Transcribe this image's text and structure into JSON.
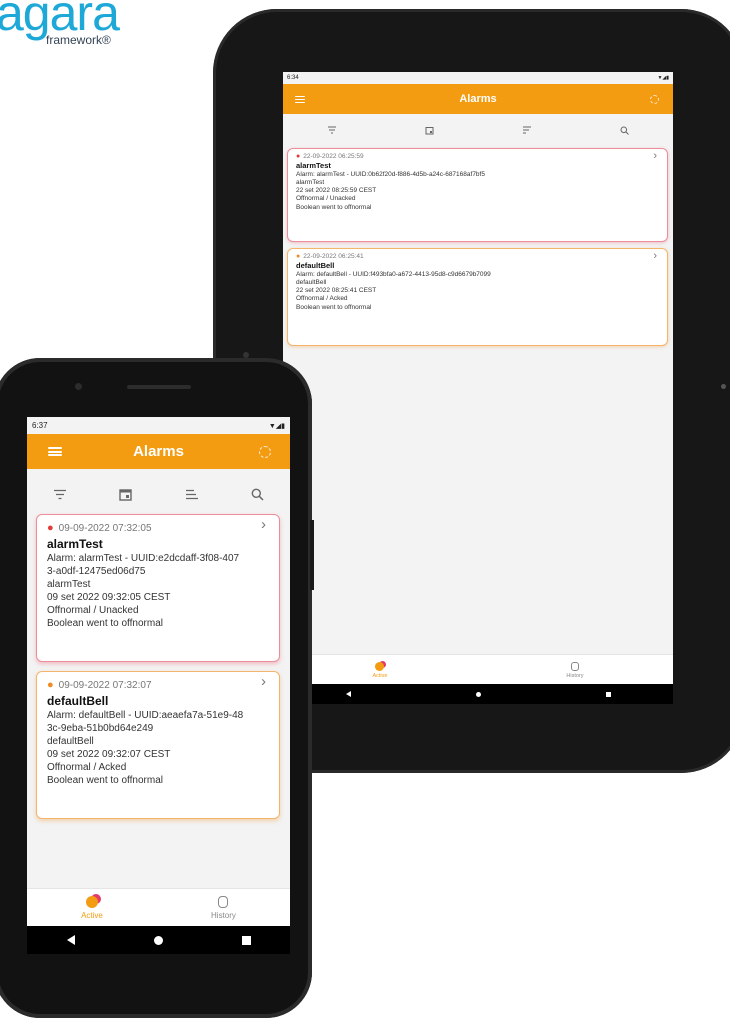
{
  "logo": {
    "word": "agara",
    "sub": "framework®"
  },
  "colors": {
    "accent": "#f39c12",
    "card_red_border": "#ec8e9a",
    "card_orange_border": "#f3b46e",
    "active_tab": "#f39c12"
  },
  "tablet": {
    "status": {
      "time": "6:34",
      "icons": "▼◢▮"
    },
    "appbar_title": "Alarms",
    "alarms": [
      {
        "timestamp": "22-09-2022 06:25:59",
        "name": "alarmTest",
        "lines": [
          "Alarm: alarmTest - UUID:0b62f20d-f886-4d5b-a24c-687168af7bf5",
          "alarmTest",
          "22 set 2022 08:25:59 CEST",
          "Offnormal / Unacked",
          "Boolean went to offnormal"
        ]
      },
      {
        "timestamp": "22-09-2022 06:25:41",
        "name": "defaultBell",
        "lines": [
          "Alarm: defaultBell - UUID:f493bfa0-a672-4413-95d8-c9d6679b7099",
          "defaultBell",
          "22 set 2022 08:25:41 CEST",
          "Offnormal / Acked",
          "Boolean went to offnormal"
        ]
      }
    ],
    "nav": {
      "active": "Active",
      "history": "History"
    }
  },
  "phone": {
    "status": {
      "time": "6:37",
      "icons": "▼◢▮"
    },
    "appbar_title": "Alarms",
    "alarms": [
      {
        "timestamp": "09-09-2022 07:32:05",
        "name": "alarmTest",
        "lines": [
          "Alarm: alarmTest - UUID:e2dcdaff-3f08-407",
          "3-a0df-12475ed06d75",
          "alarmTest",
          "09 set 2022 09:32:05 CEST",
          "Offnormal / Unacked",
          "Boolean went to offnormal"
        ]
      },
      {
        "timestamp": "09-09-2022 07:32:07",
        "name": "defaultBell",
        "lines": [
          "Alarm: defaultBell - UUID:aeaefa7a-51e9-48",
          "3c-9eba-51b0bd64e249",
          "defaultBell",
          "09 set 2022 09:32:07 CEST",
          "Offnormal / Acked",
          "Boolean went to offnormal"
        ]
      }
    ],
    "nav": {
      "active": "Active",
      "history": "History"
    }
  },
  "glyphs": {
    "chevron": "›"
  }
}
